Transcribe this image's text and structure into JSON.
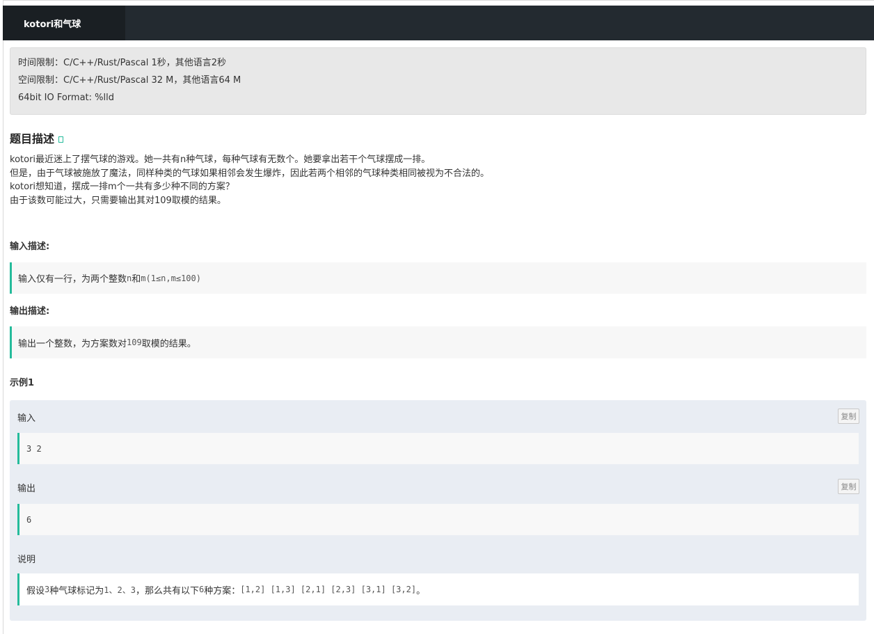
{
  "tab": {
    "title": "kotori和气球"
  },
  "limits": {
    "time": "时间限制：C/C++/Rust/Pascal 1秒，其他语言2秒",
    "space": "空间限制：C/C++/Rust/Pascal 32 M，其他语言64 M",
    "io": "64bit IO Format: %lld"
  },
  "problem": {
    "heading": "题目描述",
    "lines": [
      "kotori最近迷上了摆气球的游戏。她一共有n种气球，每种气球有无数个。她要拿出若干个气球摆成一排。",
      "但是，由于气球被施放了魔法，同样种类的气球如果相邻会发生爆炸，因此若两个相邻的气球种类相同被视为不合法的。",
      "kotori想知道，摆成一排m个一共有多少种不同的方案？",
      "由于该数可能过大，只需要输出其对109取模的结果。"
    ]
  },
  "input": {
    "label": "输入描述:",
    "text": "输入仅有一行，为两个整数",
    "var1": "n",
    "and": "和",
    "var2": "m(1≤n,m≤100)"
  },
  "output": {
    "label": "输出描述:",
    "text1": "输出一个整数，为方案数对",
    "num": "109",
    "text2": "取模的结果。"
  },
  "sample": {
    "heading": "示例1",
    "input_label": "输入",
    "input_value": "3 2",
    "output_label": "输出",
    "output_value": "6",
    "copy_label": "复制",
    "explain_label": "说明",
    "explain_p1": "假设",
    "explain_n": "3",
    "explain_p2": "种气球标记为",
    "explain_nums": "1、2、3",
    "explain_p3": "，那么共有以下",
    "explain_count": "6",
    "explain_p4": "种方案：",
    "explain_list": "[1,2] [1,3] [2,1] [2,3] [3,1] [3,2]",
    "explain_end": "。"
  }
}
